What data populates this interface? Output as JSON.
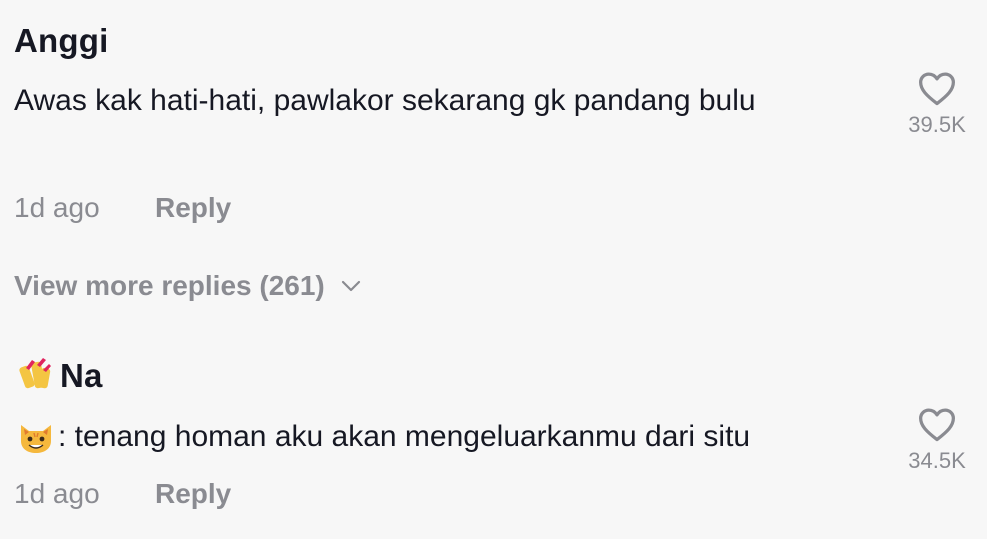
{
  "comments": [
    {
      "username": "Anggi",
      "text": "Awas kak hati-hati, pawlakor sekarang gk pandang bulu",
      "time": "1d ago",
      "reply_label": "Reply",
      "like_count": "39.5K",
      "like_icon": "heart-outline-icon"
    },
    {
      "username_emoji": "💅",
      "username": "Na",
      "text_emoji": "😺",
      "text": ": tenang homan aku akan mengeluarkanmu dari situ",
      "time": "1d ago",
      "reply_label": "Reply",
      "like_count": "34.5K",
      "like_icon": "heart-outline-icon"
    }
  ],
  "view_more": {
    "label": "View more replies (261)",
    "icon": "chevron-down-icon"
  },
  "colors": {
    "background": "#f7f7f7",
    "primary_text": "#161823",
    "secondary_text": "#8a8b91"
  }
}
